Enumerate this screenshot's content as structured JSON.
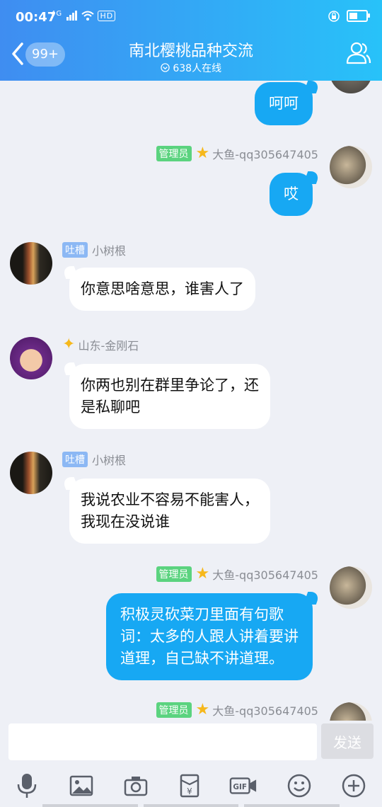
{
  "status_bar": {
    "time": "00:47",
    "network": "4G",
    "hd": "HD",
    "battery_level": 0.5
  },
  "header": {
    "unread_count": "99+",
    "title": "南北樱桃品种交流",
    "online": "638人在线"
  },
  "messages": [
    {
      "side": "out",
      "text": "呵呵"
    },
    {
      "side": "out",
      "badge": "管理员",
      "sender": "大鱼-qq305647405",
      "text": "哎"
    },
    {
      "side": "in",
      "badge": "吐槽",
      "sender": "小树根",
      "text": "你意思啥意思，谁害人了"
    },
    {
      "side": "in",
      "sender": "山东-金刚石",
      "line1": "你两也别在群里争论了，还",
      "line2": "是私聊吧"
    },
    {
      "side": "in",
      "badge": "吐槽",
      "sender": "小树根",
      "line1": "我说农业不容易不能害人，",
      "line2": "我现在没说谁"
    },
    {
      "side": "out",
      "badge": "管理员",
      "sender": "大鱼-qq305647405",
      "line1": "积极灵砍菜刀里面有句歌",
      "line2": "词：太多的人跟人讲着要讲",
      "line3": "道理，自己缺不讲道理。"
    },
    {
      "side": "out",
      "badge": "管理员",
      "sender": "大鱼-qq305647405"
    }
  ],
  "input": {
    "value": "",
    "send_label": "发送"
  },
  "colors": {
    "header_start": "#3f8df1",
    "header_end": "#28c2f9",
    "bubble_out": "#17a8f3",
    "admin_badge": "#5bd37f",
    "tucao_badge": "#8cb8f4"
  }
}
